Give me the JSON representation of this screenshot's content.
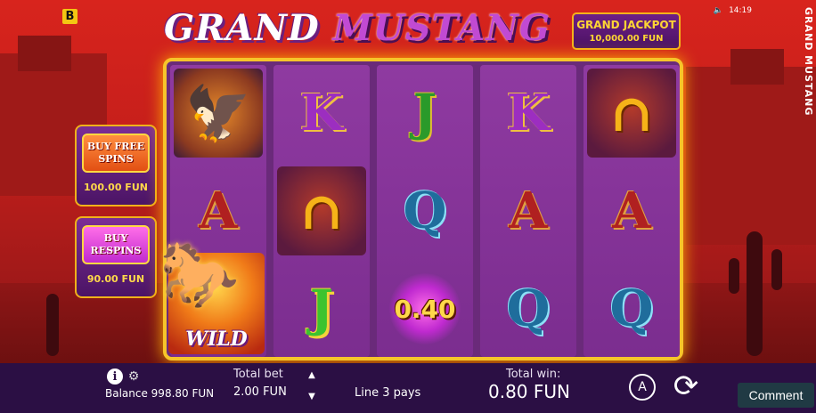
{
  "brand_badge": "B",
  "title": {
    "part1": "GRAND",
    "part2": "MUSTANG"
  },
  "jackpot": {
    "title": "GRAND JACKPOT",
    "amount": "10,000.00 FUN"
  },
  "system": {
    "time": "14:19",
    "sound_icon": "speaker-icon"
  },
  "vertical_title": "GRAND MUSTANG",
  "side_buttons": [
    {
      "label": "BUY FREE SPINS",
      "price": "100.00 FUN",
      "color": "#e8591c"
    },
    {
      "label": "BUY RESPINS",
      "price": "90.00 FUN",
      "color": "#d03ad8"
    }
  ],
  "reels": [
    {
      "symbols": [
        "eagle",
        "",
        "WILD"
      ]
    },
    {
      "symbols": [
        "K",
        "horseshoe",
        "J"
      ]
    },
    {
      "symbols": [
        "J",
        "Q",
        "0.40"
      ]
    },
    {
      "symbols": [
        "K",
        "A",
        "Q"
      ]
    },
    {
      "symbols": [
        "horseshoe",
        "A",
        "Q"
      ]
    }
  ],
  "reel_text": {
    "r1": {
      "top": "",
      "mid": "A",
      "wild": "WILD"
    },
    "r2": {
      "top": "K",
      "bot": "J"
    },
    "r3": {
      "top": "J",
      "mid": "Q",
      "coin": "0.40"
    },
    "r4": {
      "top": "K",
      "mid": "A",
      "bot": "Q"
    },
    "r5": {
      "mid": "A",
      "bot": "Q"
    }
  },
  "bottom_bar": {
    "balance": "Balance 998.80 FUN",
    "total_bet_label": "Total bet",
    "total_bet_value": "2.00 FUN",
    "line_info": "Line 3 pays",
    "total_win_label": "Total win:",
    "total_win_value": "0.80 FUN",
    "auto_label": "A"
  },
  "comment_button": "Comment",
  "colors": {
    "frame": "#f6c52a",
    "bar": "#2b0f44",
    "background": "#c71f1b"
  }
}
